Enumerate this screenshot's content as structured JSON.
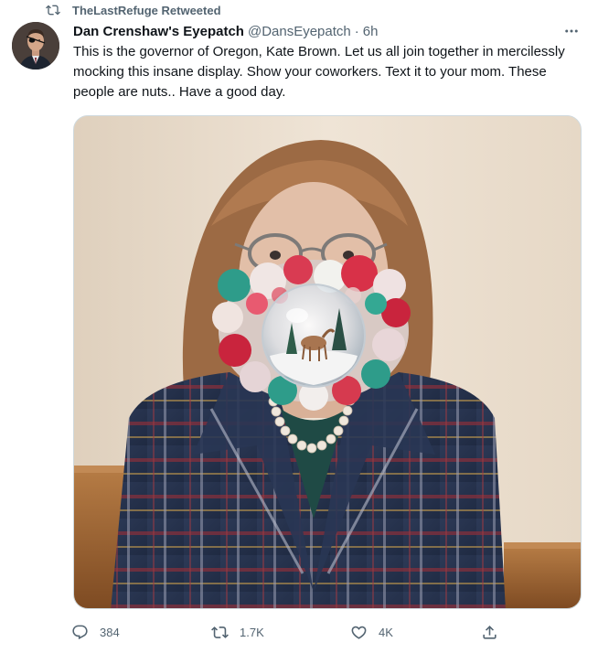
{
  "retweet_context": {
    "text": "TheLastRefuge Retweeted"
  },
  "author": {
    "display_name": "Dan Crenshaw's Eyepatch",
    "handle": "@DansEyepatch",
    "separator": "·",
    "timestamp": "6h"
  },
  "tweet": {
    "text": "This is the governor of Oregon, Kate Brown. Let us all join together in mercilessly mocking this insane display. Show your coworkers. Text it to your mom. These people are nuts.. Have a good day."
  },
  "actions": {
    "reply_count": "384",
    "retweet_count": "1.7K",
    "like_count": "4K"
  },
  "icons": {
    "retweet_context": "retweet-icon",
    "more": "more-icon",
    "reply": "reply-icon",
    "retweet": "retweet-icon",
    "like": "heart-icon",
    "share": "share-icon"
  },
  "colors": {
    "text_primary": "#0f1419",
    "text_secondary": "#536471",
    "border": "#cfd9de"
  }
}
